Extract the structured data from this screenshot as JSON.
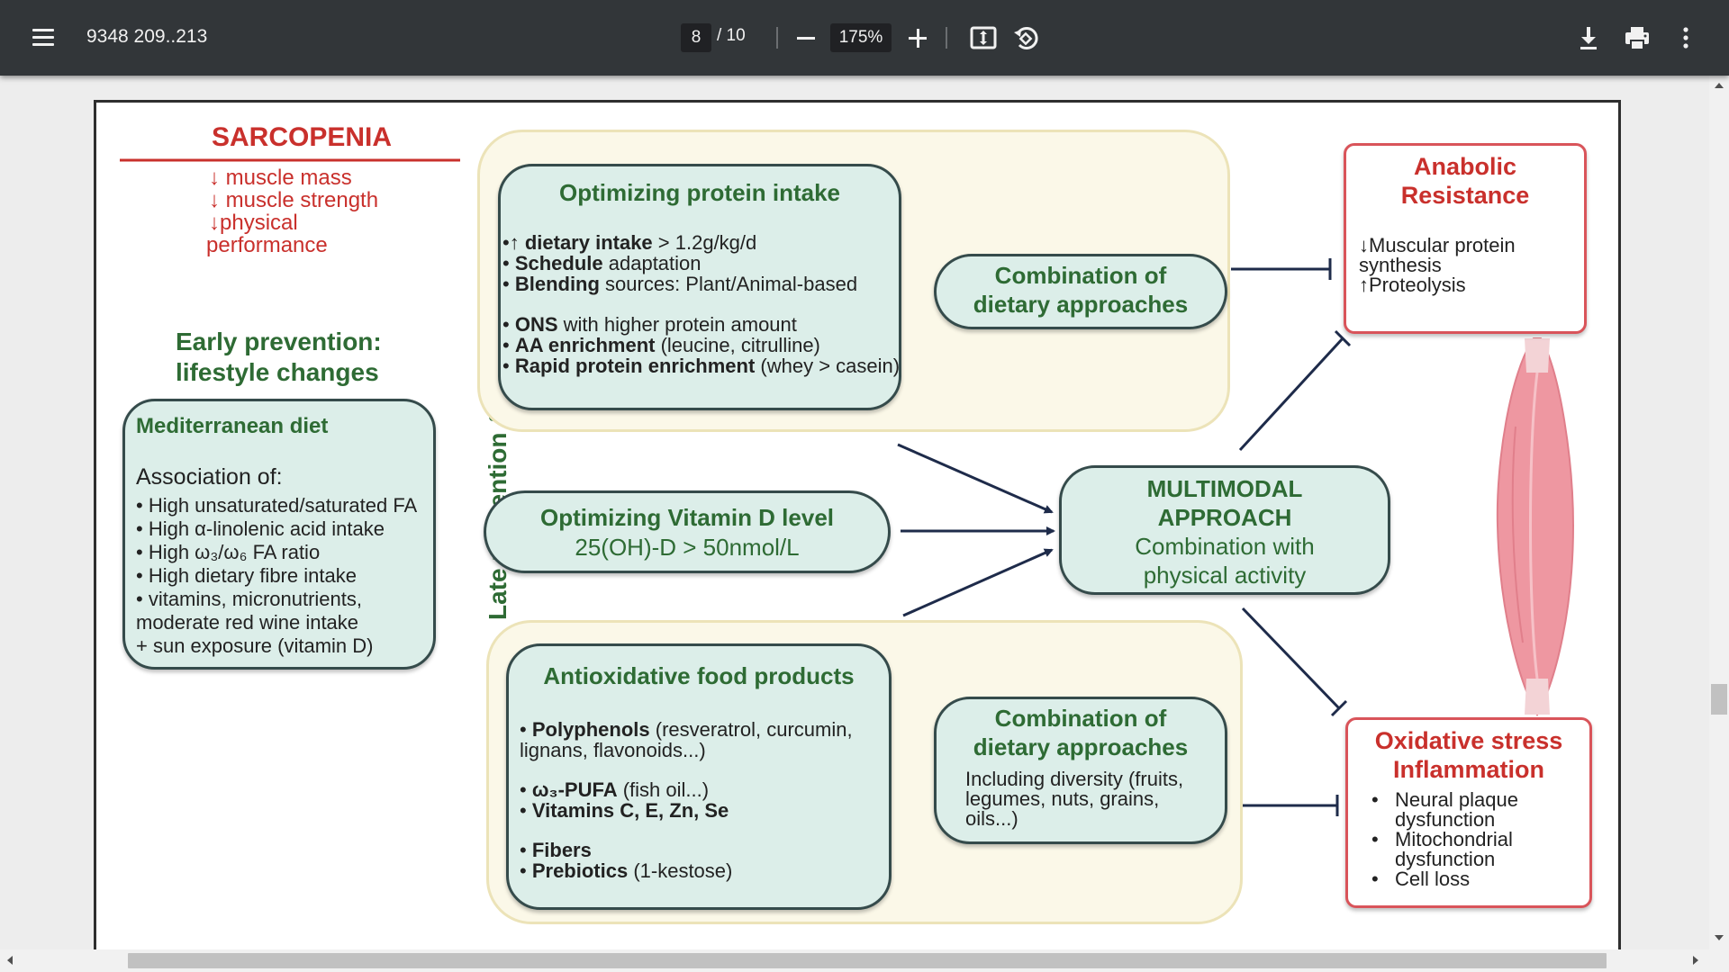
{
  "toolbar": {
    "title": "9348 209..213",
    "page_current": "8",
    "page_total": "/ 10",
    "zoom": "175%"
  },
  "figure": {
    "sarcopenia": {
      "title": "SARCOPENIA",
      "lines": [
        "↓ muscle mass",
        "↓ muscle strength",
        "↓physical",
        "performance"
      ]
    },
    "early_prevention": {
      "heading": [
        "Early prevention:",
        "lifestyle changes"
      ],
      "box_title": "Mediterranean diet",
      "assoc": "Association of:",
      "items": [
        "• High unsaturated/saturated FA",
        "• High α-linolenic acid intake",
        "• High ω₃/ω₆ FA ratio",
        "• High dietary fibre intake",
        "• vitamins, micronutrients,",
        "moderate red wine intake",
        "+ sun exposure (vitamin D)"
      ]
    },
    "late_label": "Late prevention & care",
    "protein": {
      "title": "Optimizing protein intake",
      "rows": [
        {
          "bullet": "•↑ ",
          "bold": "dietary intake",
          "rest": " > 1.2g/kg/d"
        },
        {
          "bullet": "• ",
          "bold": "Schedule",
          "rest": " adaptation"
        },
        {
          "bullet": "• ",
          "bold": "Blending",
          "rest": " sources: Plant/Animal-based"
        },
        {
          "bullet": "• ",
          "bold": "ONS",
          "rest": " with higher protein amount"
        },
        {
          "bullet": "• ",
          "bold": "AA enrichment",
          "rest": " (leucine, citrulline)"
        },
        {
          "bullet": "• ",
          "bold": "Rapid protein enrichment",
          "rest": " (whey > casein)"
        }
      ]
    },
    "combo_top": [
      "Combination of",
      "dietary approaches"
    ],
    "vitamin_d": [
      "Optimizing Vitamin D level",
      "25(OH)-D > 50nmol/L"
    ],
    "multimodal": [
      "MULTIMODAL",
      "APPROACH",
      "Combination with",
      "physical activity"
    ],
    "antiox": {
      "title": "Antioxidative food products",
      "rows": [
        {
          "bullet": "• ",
          "bold": "Polyphenols",
          "rest": " (resveratrol, curcumin,"
        },
        {
          "bullet": "",
          "bold": "",
          "rest": "lignans, flavonoids...)"
        },
        {
          "bullet": "• ",
          "bold": "ω₃-PUFA",
          "rest": " (fish oil...)"
        },
        {
          "bullet": "• ",
          "bold": "Vitamins C, E, Zn, Se",
          "rest": ""
        },
        {
          "bullet": "• ",
          "bold": "Fibers",
          "rest": ""
        },
        {
          "bullet": "• ",
          "bold": "Prebiotics",
          "rest": " (1-kestose)"
        }
      ]
    },
    "combo_bottom": {
      "title": [
        "Combination of",
        "dietary approaches"
      ],
      "body": [
        "Including diversity (fruits,",
        "legumes, nuts, grains,",
        "oils...)"
      ]
    },
    "anabolic": {
      "title": [
        "Anabolic",
        "Resistance"
      ],
      "body": [
        "↓Muscular protein",
        "synthesis",
        "↑Proteolysis"
      ]
    },
    "oxidative": {
      "title": [
        "Oxidative stress",
        "Inflammation"
      ],
      "items": [
        "•",
        "Neural plaque",
        "dysfunction",
        "•",
        "Mitochondrial",
        "dysfunction",
        "•",
        "Cell loss"
      ]
    }
  },
  "colors": {
    "toolbar": "#323639",
    "box_fill": "#dceee9",
    "panel_fill": "#fbf8e8",
    "red": "#c9302c",
    "green": "#2e6b34"
  },
  "icons": [
    "menu-icon",
    "zoom-out-icon",
    "zoom-in-icon",
    "fit-page-icon",
    "rotate-icon",
    "download-icon",
    "print-icon",
    "more-options-icon"
  ]
}
